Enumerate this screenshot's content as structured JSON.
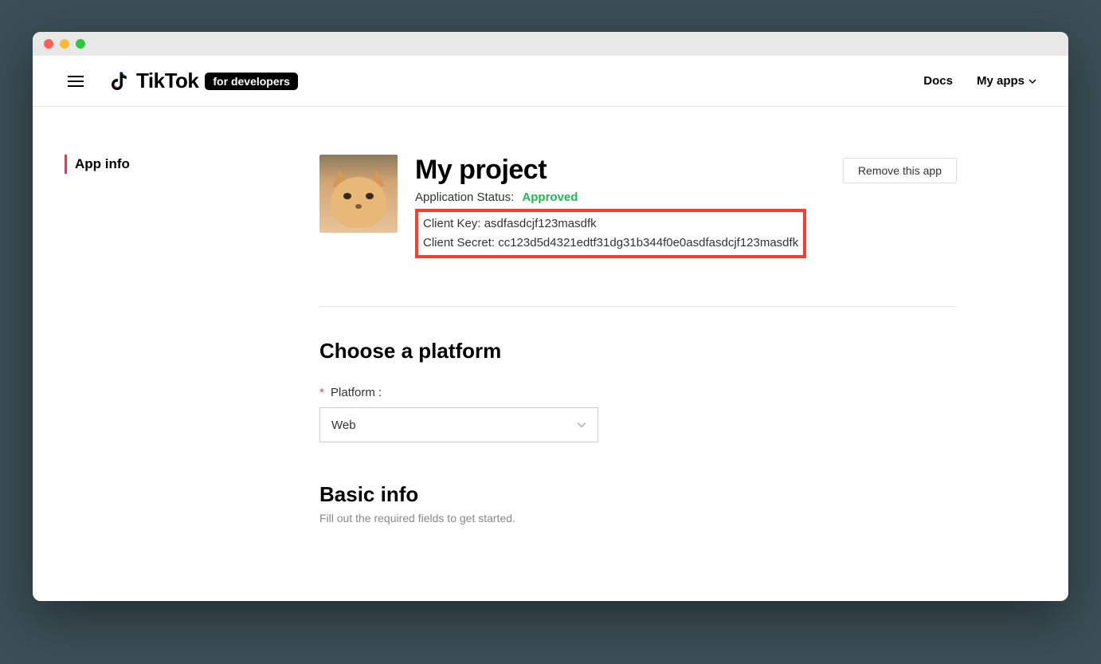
{
  "brand": {
    "name": "TikTok",
    "badge": "for developers"
  },
  "nav": {
    "docs": "Docs",
    "myapps": "My apps"
  },
  "sidebar": {
    "app_info": "App info"
  },
  "app": {
    "title": "My project",
    "status_label": "Application Status:",
    "status_value": "Approved",
    "client_key_label": "Client Key:",
    "client_key_value": "asdfasdcjf123masdfk",
    "client_secret_label": "Client Secret:",
    "client_secret_value": "cc123d5d4321edtf31dg31b344f0e0asdfasdcjf123masdfk",
    "remove_label": "Remove this app"
  },
  "platform": {
    "section_title": "Choose a platform",
    "field_label": "Platform",
    "selected": "Web"
  },
  "basic": {
    "title": "Basic info",
    "subtitle": "Fill out the required fields to get started."
  }
}
